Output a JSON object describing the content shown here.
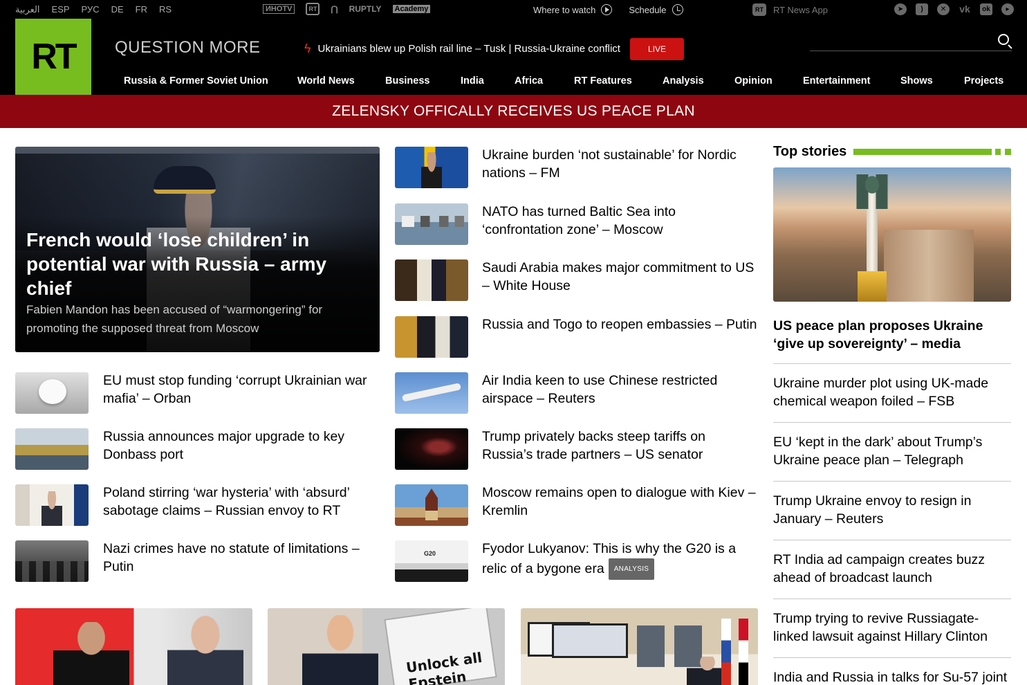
{
  "topbar": {
    "languages": [
      "العربية",
      "ESP",
      "РУС",
      "DE",
      "FR",
      "RS"
    ],
    "partners": [
      "ИНОТV",
      "RT",
      "RUPTLY",
      "Academy"
    ],
    "where_to_watch": "Where to watch",
    "schedule": "Schedule",
    "app_label": "RT News App",
    "socials": [
      "telegram-icon",
      "rss-icon",
      "x-icon",
      "vk-icon",
      "odnoklassniki-icon",
      "rumble-icon"
    ]
  },
  "header": {
    "logo": "RT",
    "slogan": "QUESTION MORE",
    "ticker": "Ukrainians blew up Polish rail line – Tusk | Russia-Ukraine conflict",
    "live": "LIVE",
    "search_placeholder": "",
    "nav": [
      "Russia & Former Soviet Union",
      "World News",
      "Business",
      "India",
      "Africa",
      "RT Features",
      "Analysis",
      "Opinion",
      "Entertainment",
      "Shows",
      "Projects"
    ]
  },
  "banner": "ZELENSKY OFFICALLY RECEIVES US PEACE PLAN",
  "lead": {
    "title": "French would ‘lose children’ in potential war with Russia – army chief",
    "summary": "Fabien Mandon has been accused of “warmongering” for promoting the supposed threat from Moscow"
  },
  "left_list": [
    "EU must stop funding ‘corrupt Ukrainian war mafia’ – Orban",
    "Russia announces major upgrade to key Donbass port",
    "Poland stirring ‘war hysteria’ with ‘absurd’ sabotage claims – Russian envoy to RT",
    "Nazi crimes have no statute of limitations – Putin"
  ],
  "middle_list": [
    "Ukraine burden ‘not sustainable’ for Nordic nations – FM",
    "NATO has turned Baltic Sea into ‘confrontation zone’ – Moscow",
    "Saudi Arabia makes major commitment to US – White House",
    "Russia and Togo to reopen embassies – Putin",
    "Air India keen to use Chinese restricted airspace – Reuters",
    "Trump privately backs steep tariffs on Russia’s trade partners – US senator",
    "Moscow remains open to dialogue with Kiev – Kremlin",
    "Fyodor Lukyanov: This is why the G20 is a relic of a bygone era"
  ],
  "analysis_badge": "ANALYSIS",
  "top_stories": {
    "heading": "Top stories",
    "lead": "US peace plan proposes Ukraine ‘give up sovereignty’ – media",
    "items": [
      "Ukraine murder plot using UK-made chemical weapon foiled – FSB",
      "EU ‘kept in the dark’ about Trump’s Ukraine peace plan – Telegraph",
      "Trump Ukraine envoy to resign in January – Reuters",
      "RT India ad campaign creates buzz ahead of broadcast launch",
      "Trump trying to revive Russiagate-linked lawsuit against Hillary Clinton",
      "India and Russia in talks for Su-57 joint"
    ]
  },
  "cards": {
    "sign_text": "Unlock all Epstein Files!"
  },
  "colors": {
    "brand_green": "#77bd1f",
    "banner_red": "#8e0610",
    "live_red": "#cc1111"
  }
}
